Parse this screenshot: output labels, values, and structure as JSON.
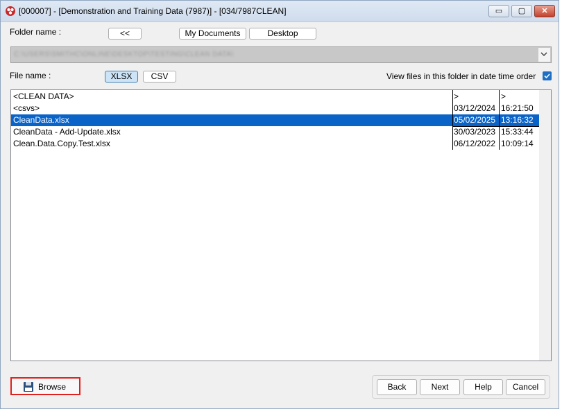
{
  "window": {
    "title": "[000007] - [Demonstration and Training Data (7987)] - [034/7987CLEAN]",
    "minimize_glyph": "▭",
    "maximize_glyph": "▢",
    "close_glyph": "✕"
  },
  "folder": {
    "label": "Folder name :",
    "back_label": "<<",
    "my_documents_label": "My Documents",
    "desktop_label": "Desktop",
    "path": "C:\\USERS\\SMITHC\\ONLINE\\DESKTOP\\TESTING\\CLEAN DATA\\"
  },
  "file": {
    "label": "File name :",
    "xlsx_label": "XLSX",
    "csv_label": "CSV",
    "date_order_label": "View files in this folder in date time order",
    "date_order_checked": true
  },
  "files": [
    {
      "name": "<CLEAN DATA>",
      "date": ">",
      "time": ">",
      "selected": false
    },
    {
      "name": "<csvs>",
      "date": "03/12/2024",
      "time": "16:21:50",
      "selected": false
    },
    {
      "name": "CleanData.xlsx",
      "date": "05/02/2025",
      "time": "13:16:32",
      "selected": true
    },
    {
      "name": "CleanData - Add-Update.xlsx",
      "date": "30/03/2023",
      "time": "15:33:44",
      "selected": false
    },
    {
      "name": "Clean.Data.Copy.Test.xlsx",
      "date": "06/12/2022",
      "time": "10:09:14",
      "selected": false
    }
  ],
  "footer": {
    "browse_label": "Browse",
    "back_label": "Back",
    "next_label": "Next",
    "help_label": "Help",
    "cancel_label": "Cancel"
  },
  "colors": {
    "selection": "#0a64c8",
    "highlight_border": "#e0201c"
  }
}
